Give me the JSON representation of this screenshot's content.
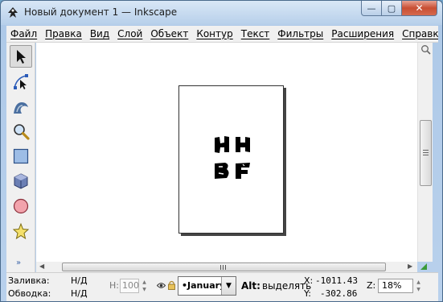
{
  "window": {
    "title": "Новый документ 1 — Inkscape",
    "controls": {
      "minimize": "—",
      "maximize": "▢",
      "close": "✕"
    }
  },
  "menu": [
    "Файл",
    "Правка",
    "Вид",
    "Слой",
    "Объект",
    "Контур",
    "Текст",
    "Фильтры",
    "Расширения",
    "Справка"
  ],
  "tools": [
    {
      "name": "selector-tool-icon",
      "active": true
    },
    {
      "name": "node-tool-icon",
      "active": false
    },
    {
      "name": "tweak-tool-icon",
      "active": false
    },
    {
      "name": "zoom-tool-icon",
      "active": false
    },
    {
      "name": "rectangle-tool-icon",
      "active": false
    },
    {
      "name": "3d-box-tool-icon",
      "active": false
    },
    {
      "name": "ellipse-tool-icon",
      "active": false
    },
    {
      "name": "star-tool-icon",
      "active": false
    }
  ],
  "toolbox_more": "»",
  "status": {
    "fill_label": "Заливка:",
    "fill_value": "Н/Д",
    "stroke_label": "Обводка:",
    "stroke_value": "Н/Д",
    "opacity_label": "Н:",
    "opacity_value": "100",
    "layer": "•January",
    "hint_key": "Alt:",
    "hint_text": "выделять",
    "x_label": "X:",
    "x_value": "-1011.43",
    "y_label": "Y:",
    "y_value": "-302.86",
    "zoom_label": "Z:",
    "zoom_value": "18%"
  },
  "colors": {
    "accent": "#3a63a8",
    "close_button": "#c84e33",
    "canvas": "#ffffff"
  }
}
